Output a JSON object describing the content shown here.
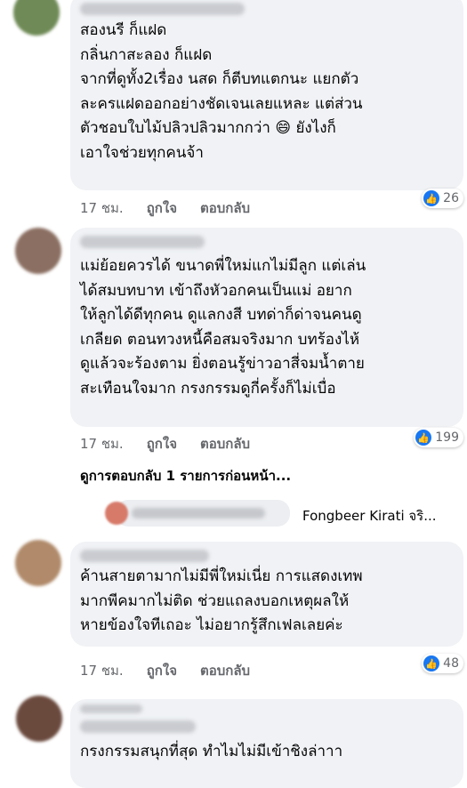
{
  "comments": [
    {
      "text": "สองนรี ก็แฝด\nกลิ่นกาสะลอง ก็แฝด\nจากที่ดูทั้ง2เรื่อง นสด ก็ตีบทแตกนะ แยกตัว\nละครแฝดออกอย่างชัดเจนเลยแหละ แต่ส่วน\nตัวชอบใบไม้ปลิวปลิวมากกว่า 😄 ยังไงก็\nเอาใจช่วยทุกคนจ้า",
      "time": "17 ชม.",
      "like": "ถูกใจ",
      "reply": "ตอบกลับ",
      "reactions": "26"
    },
    {
      "text": "แม่ย้อยควรได้ ขนาดพี่ใหม่แกไม่มีลูก แต่เล่น\nได้สมบทบาท เข้าถึงหัวอกคนเป็นแม่ อยาก\nให้ลูกได้ดีทุกคน ดูแลกงสี บทด่าก็ด่าจนคนดู\nเกลียด ตอนทวงหนี้คือสมจริงมาก บทร้องไห้\nดูแล้วจะร้องตาม ยิ่งตอนรู้ข่าวอาสี่จมน้ำตาย\nสะเทือนใจมาก กรงกรรมดูกี่ครั้งก็ไม่เบื่อ",
      "time": "17 ชม.",
      "like": "ถูกใจ",
      "reply": "ตอบกลับ",
      "reactions": "199"
    },
    {
      "text": "ค้านสายตามากไม่มีพี่ใหม่เนี่ย การแสดงเทพ\nมากพีคมากไม่ติด ช่วยแถลงบอกเหตุผลให้\nหายข้องใจทีเถอะ ไม่อยากรู้สึกเฟลเลยค่ะ",
      "time": "17 ชม.",
      "like": "ถูกใจ",
      "reply": "ตอบกลับ",
      "reactions": "48"
    },
    {
      "text": "กรงกรรมสนุกที่สุด ทำไมไม่มีเข้าชิงล่าาา"
    }
  ],
  "view_previous_replies": "ดูการตอบกลับ 1 รายการก่อนหน้า...",
  "reply_preview_name": "Fongbeer Kirati จริ...",
  "colors": {
    "like_blue": "#1877f2",
    "bubble_bg": "#f0f2f5",
    "muted": "#65676b"
  }
}
